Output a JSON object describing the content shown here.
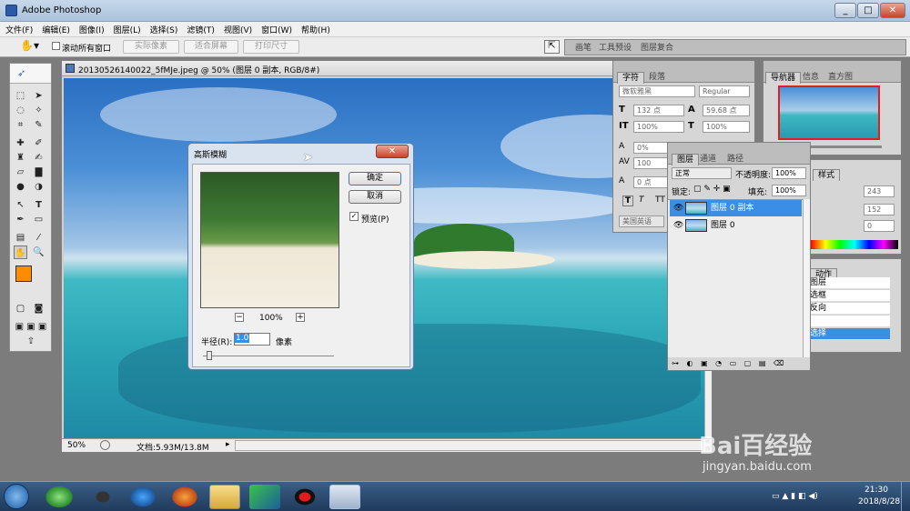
{
  "app": {
    "title": "Adobe Photoshop",
    "controls": [
      "_",
      "□",
      "✕"
    ]
  },
  "menu": [
    "文件(F)",
    "编辑(E)",
    "图像(I)",
    "图层(L)",
    "选择(S)",
    "滤镜(T)",
    "视图(V)",
    "窗口(W)",
    "帮助(H)"
  ],
  "options": {
    "scroll_all": "滚动所有窗口",
    "actual_pixels": "实际像素",
    "fit_screen": "适合屏幕",
    "print_size": "打印尺寸",
    "well_tabs": [
      "画笔",
      "工具预设",
      "图层复合"
    ]
  },
  "document": {
    "title": "20130526140022_5fMJe.jpeg @ 50% (图层 0 副本, RGB/8#)",
    "zoom": "50%",
    "docinfo": "文档:5.93M/13.8M"
  },
  "char_panel": {
    "tabs": [
      "字符",
      "段落"
    ],
    "font": "微软雅黑",
    "style": "Regular",
    "size": "132 点",
    "leading": "59.68 点",
    "vscale": "100%",
    "hscale": "100%",
    "baseline": "0%",
    "tracking": "100",
    "kerning": "0 点",
    "language": "美国英语",
    "typo": [
      "T",
      "T",
      "TT"
    ]
  },
  "navigator": {
    "tabs": [
      "导航器",
      "信息",
      "直方图"
    ]
  },
  "styles": {
    "tab": "样式",
    "values": [
      "243",
      "152",
      "0"
    ]
  },
  "actions": {
    "tab": "动作",
    "items": [
      "图层",
      "选框",
      "反向",
      "",
      "选择"
    ]
  },
  "layers": {
    "tabs": [
      "图层",
      "通道",
      "路径"
    ],
    "blend": "正常",
    "opacity_label": "不透明度:",
    "opacity": "100%",
    "lock_label": "锁定:",
    "fill_label": "填充:",
    "fill": "100%",
    "items": [
      {
        "name": "图层 0 副本",
        "selected": true
      },
      {
        "name": "图层 0",
        "selected": false
      }
    ]
  },
  "dialog": {
    "title": "高斯模糊",
    "ok": "确定",
    "cancel": "取消",
    "preview": "预览(P)",
    "zoom": "100%",
    "radius_label": "半径(R):",
    "radius": "1.0",
    "unit": "像素"
  },
  "taskbar": {
    "time": "21:30",
    "date": "2018/8/28"
  },
  "watermark": {
    "brand": "Bai百经验",
    "url": "jingyan.baidu.com"
  }
}
